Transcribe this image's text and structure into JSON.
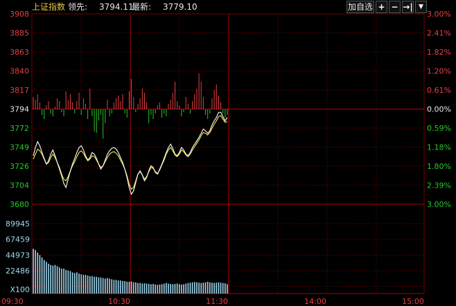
{
  "topbar": {
    "index_name": "上证指数",
    "leader_label": "领先:",
    "leader_value": "3794.11",
    "latest_label": "最新:",
    "latest_value": "3779.10",
    "add_watch_label": "加自选",
    "plus_icon": "+",
    "minus_icon": "−",
    "pin_icon": "→|",
    "menu_icon": "▼"
  },
  "colors": {
    "background": "#000000",
    "grid": "#7a0000",
    "grid_strong": "#b00000",
    "up": "#e84040",
    "down": "#28c828",
    "neutral_text": "#e8e8e8",
    "price_line": "#f0f0f0",
    "avg_line": "#f0e040",
    "volume": "#a0d8f0"
  },
  "chart_data": {
    "type": "line",
    "prev_close": 3794.11,
    "latest": 3779.1,
    "price_axis_ticks": [
      "3908",
      "3885",
      "3863",
      "3840",
      "3817",
      "3794",
      "3772",
      "3749",
      "3726",
      "3704",
      "3680"
    ],
    "percent_axis_ticks": [
      "3.00%",
      "2.41%",
      "1.82%",
      "1.20%",
      "0.61%",
      "0.00%",
      "0.59%",
      "1.18%",
      "1.80%",
      "2.39%",
      "3.00%"
    ],
    "volume_axis_ticks": [
      "89945",
      "67459",
      "44973",
      "22486"
    ],
    "volume_unit_label": "X100",
    "time_ticks": [
      "09:30",
      "10:30",
      "11:30",
      "14:00",
      "15:00"
    ],
    "ylim": [
      3680,
      3908
    ],
    "price_series": [
      3738,
      3748,
      3755,
      3750,
      3742,
      3735,
      3728,
      3732,
      3740,
      3745,
      3738,
      3730,
      3722,
      3714,
      3705,
      3700,
      3710,
      3720,
      3728,
      3735,
      3742,
      3748,
      3750,
      3745,
      3738,
      3733,
      3736,
      3742,
      3740,
      3735,
      3728,
      3722,
      3726,
      3733,
      3740,
      3744,
      3747,
      3748,
      3746,
      3742,
      3736,
      3730,
      3722,
      3712,
      3700,
      3692,
      3696,
      3706,
      3716,
      3720,
      3715,
      3708,
      3712,
      3720,
      3726,
      3724,
      3718,
      3716,
      3722,
      3728,
      3735,
      3742,
      3748,
      3752,
      3747,
      3740,
      3738,
      3742,
      3748,
      3745,
      3740,
      3738,
      3742,
      3748,
      3752,
      3756,
      3760,
      3765,
      3770,
      3768,
      3765,
      3768,
      3775,
      3780,
      3784,
      3790,
      3790,
      3785,
      3780,
      3784
    ],
    "avg_series": [
      3734,
      3740,
      3746,
      3744,
      3740,
      3734,
      3728,
      3730,
      3736,
      3740,
      3736,
      3730,
      3724,
      3716,
      3710,
      3708,
      3713,
      3720,
      3726,
      3731,
      3737,
      3742,
      3744,
      3741,
      3736,
      3732,
      3734,
      3738,
      3737,
      3733,
      3728,
      3724,
      3726,
      3731,
      3736,
      3740,
      3742,
      3743,
      3741,
      3738,
      3733,
      3728,
      3722,
      3714,
      3704,
      3698,
      3700,
      3708,
      3716,
      3719,
      3715,
      3710,
      3713,
      3719,
      3724,
      3723,
      3719,
      3717,
      3721,
      3727,
      3733,
      3740,
      3745,
      3748,
      3744,
      3739,
      3737,
      3740,
      3745,
      3743,
      3739,
      3737,
      3740,
      3745,
      3749,
      3753,
      3757,
      3762,
      3766,
      3765,
      3763,
      3766,
      3771,
      3776,
      3780,
      3785,
      3786,
      3782,
      3778,
      3779
    ],
    "breadth_series": [
      18,
      14,
      22,
      10,
      -8,
      -14,
      6,
      12,
      -6,
      -10,
      4,
      16,
      12,
      -4,
      -10,
      26,
      14,
      22,
      10,
      -6,
      12,
      24,
      -8,
      16,
      8,
      -14,
      30,
      -10,
      -32,
      -34,
      -16,
      -8,
      -42,
      -20,
      14,
      -10,
      -6,
      10,
      16,
      20,
      12,
      22,
      -6,
      -12,
      26,
      44,
      18,
      -4,
      8,
      16,
      30,
      24,
      10,
      -20,
      -8,
      -14,
      -6,
      6,
      10,
      -12,
      -6,
      -10,
      8,
      14,
      24,
      40,
      12,
      6,
      -10,
      -4,
      18,
      8,
      -6,
      12,
      22,
      30,
      52,
      40,
      18,
      -8,
      -14,
      -6,
      16,
      28,
      36,
      20,
      10,
      -6,
      -12,
      -8
    ],
    "volume_series": [
      72000,
      70000,
      66000,
      62000,
      58000,
      54000,
      51000,
      48000,
      46000,
      45000,
      46000,
      44000,
      42000,
      40000,
      40000,
      38000,
      37000,
      36000,
      34000,
      33000,
      34000,
      32000,
      31000,
      30000,
      30000,
      29000,
      28000,
      28000,
      27000,
      27000,
      26000,
      26000,
      25000,
      24000,
      25000,
      24000,
      23000,
      22000,
      22000,
      21000,
      21000,
      20000,
      20000,
      19000,
      19000,
      19500,
      18000,
      18000,
      17000,
      17000,
      16000,
      16500,
      16000,
      15500,
      15000,
      15500,
      14500,
      14000,
      14500,
      15000,
      16000,
      17000,
      16000,
      15500,
      15000,
      15500,
      16000,
      15000,
      14500,
      15000,
      16000,
      17000,
      17500,
      18000,
      18500,
      18000,
      17500,
      17000,
      17500,
      18000,
      19000,
      18000,
      17500,
      17000,
      17500,
      18000,
      17500,
      17000,
      16500,
      15000
    ],
    "grid": true
  }
}
